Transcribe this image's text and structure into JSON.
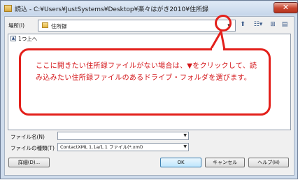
{
  "window": {
    "title": "読込 - C:¥Users¥JustSystems¥Desktop¥楽々はがき2010¥住所録",
    "close_label": "✕"
  },
  "location": {
    "label": "場所(I)",
    "value": "住所録"
  },
  "filelist": {
    "up_label": "1つ上へ"
  },
  "callout": {
    "text": "ここに開きたい住所録ファイルがない場合は、▼をクリックして、読み込みたい住所録ファイルのあるドライブ・フォルダを選びます。"
  },
  "fields": {
    "filename_label": "ファイル名(N)",
    "filename_value": "",
    "filetype_label": "ファイルの種類(T)",
    "filetype_value": "ContactXML 1.1a/1.1 ファイル(*.xml)"
  },
  "buttons": {
    "details": "詳細(D)...",
    "ok": "OK",
    "cancel": "キャンセル",
    "help": "ヘルプ(H)"
  },
  "icons": {
    "dropdown": "chevron-down-icon",
    "up_folder": "folder-up-icon",
    "view_menu": "view-menu-icon",
    "new_folder": "new-folder-icon",
    "delete": "delete-icon"
  },
  "colors": {
    "accent_red": "#e3201b",
    "callout_text": "#d4161a"
  }
}
